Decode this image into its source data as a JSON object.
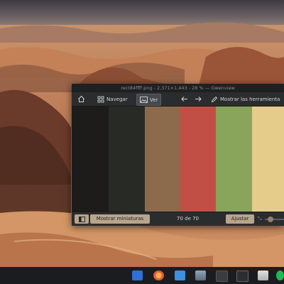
{
  "window": {
    "title": "rect84ffff.png - 2,371×1,443 - 28 % — Gwenview"
  },
  "toolbar": {
    "home_icon": "home-icon",
    "navigate_label": "Navegar",
    "view_label": "Ver",
    "show_tools_label": "Mostrar las herramienta"
  },
  "image": {
    "palette": [
      "#1d1c1b",
      "#282b25",
      "#8c6a4c",
      "#c24f45",
      "#88a55b",
      "#e6cc8a"
    ]
  },
  "statusbar": {
    "thumbnails_label": "Mostrar miniaturas",
    "position_text": "70 de 70",
    "fit_label": "Ajustar"
  },
  "taskbar": {
    "apps": [
      "firefox-icon",
      "files-icon",
      "gwenview-icon",
      "terminal-icon",
      "calculator-icon",
      "discover-icon",
      "spotify-icon"
    ]
  }
}
